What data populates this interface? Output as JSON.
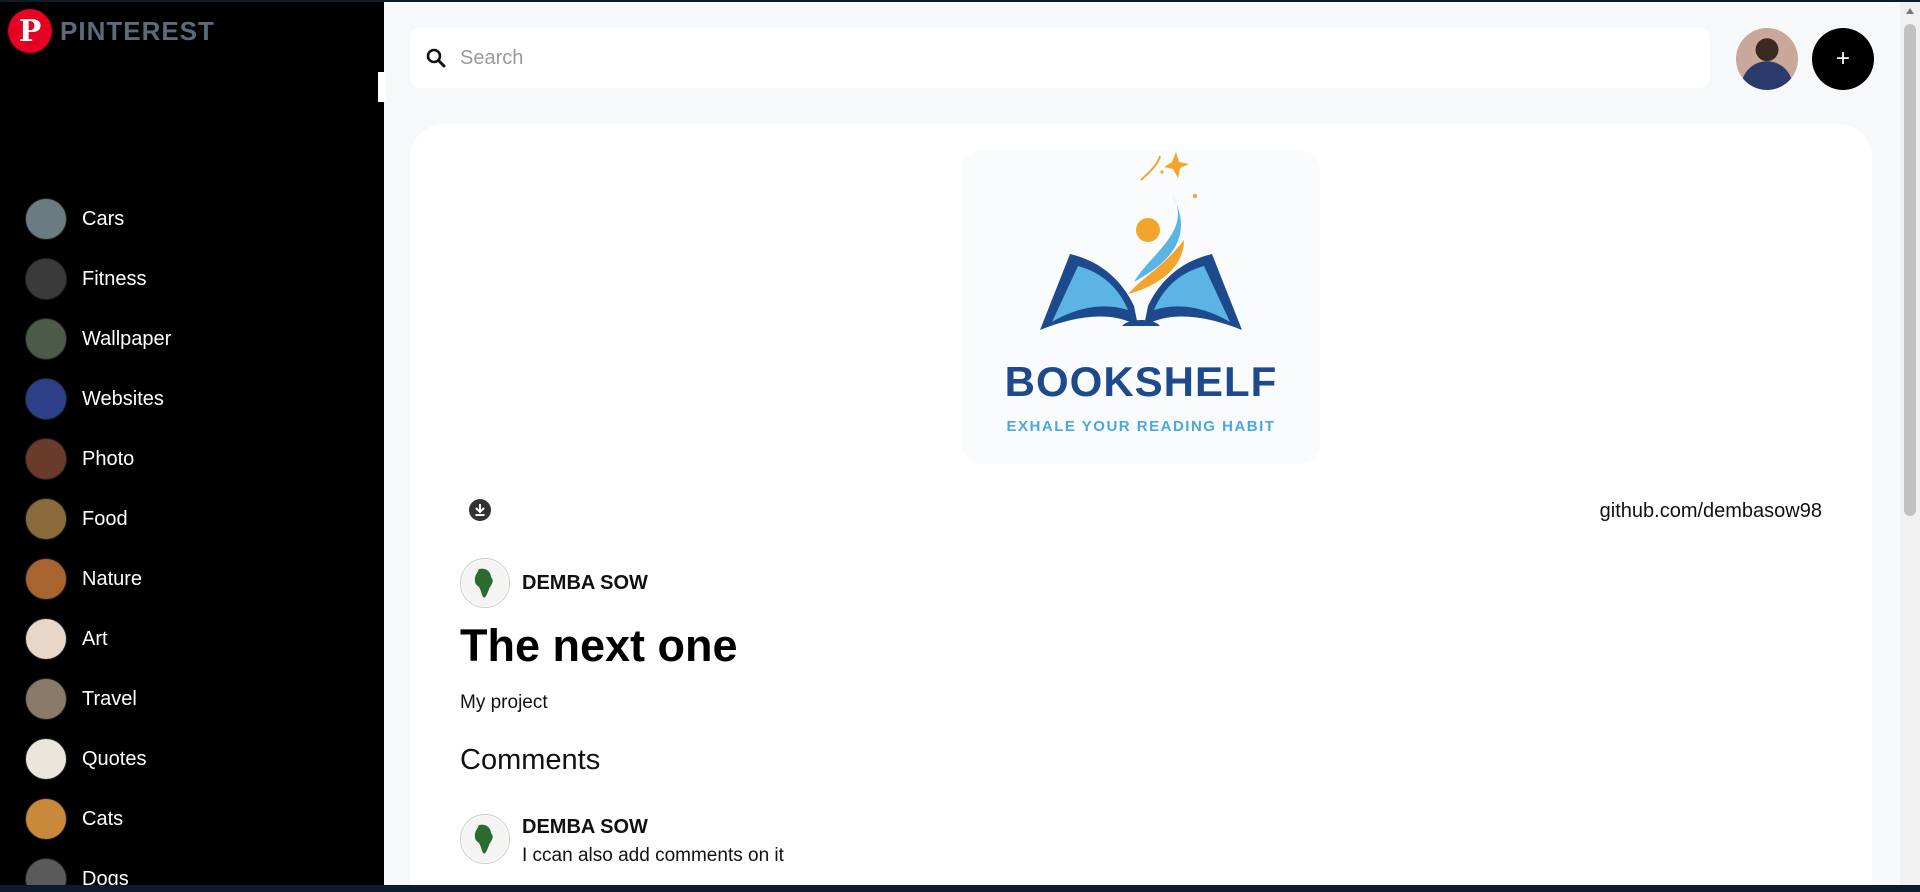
{
  "brand": {
    "logo_letter": "P",
    "name": "PINTEREST",
    "color": "#e60023"
  },
  "categories": [
    {
      "label": "Cars",
      "thumb": "#6b7b82"
    },
    {
      "label": "Fitness",
      "thumb": "#3a3a3a"
    },
    {
      "label": "Wallpaper",
      "thumb": "#4d5a4a"
    },
    {
      "label": "Websites",
      "thumb": "#2e3f8a"
    },
    {
      "label": "Photo",
      "thumb": "#6a3a2a"
    },
    {
      "label": "Food",
      "thumb": "#8a6a3a"
    },
    {
      "label": "Nature",
      "thumb": "#a8642e"
    },
    {
      "label": "Art",
      "thumb": "#e8d6c8"
    },
    {
      "label": "Travel",
      "thumb": "#8a7a6a"
    },
    {
      "label": "Quotes",
      "thumb": "#eae6dc"
    },
    {
      "label": "Cats",
      "thumb": "#c88a3a"
    },
    {
      "label": "Dogs",
      "thumb": "#5a5a5a"
    }
  ],
  "search": {
    "placeholder": "Search"
  },
  "header": {
    "add_label": "+"
  },
  "pin": {
    "image_title": "BOOKSHELF",
    "image_tagline": "EXHALE YOUR READING HABIT",
    "link": "github.com/dembasow98",
    "author": "DEMBA SOW",
    "title": "The next one",
    "description": "My project",
    "comments_heading": "Comments",
    "comments": [
      {
        "author": "DEMBA SOW",
        "text": "I ccan also add comments on it"
      }
    ]
  },
  "colors": {
    "sidebar_bg": "#000000",
    "page_bg": "#f7f8f9",
    "card_bg": "#ffffff"
  }
}
